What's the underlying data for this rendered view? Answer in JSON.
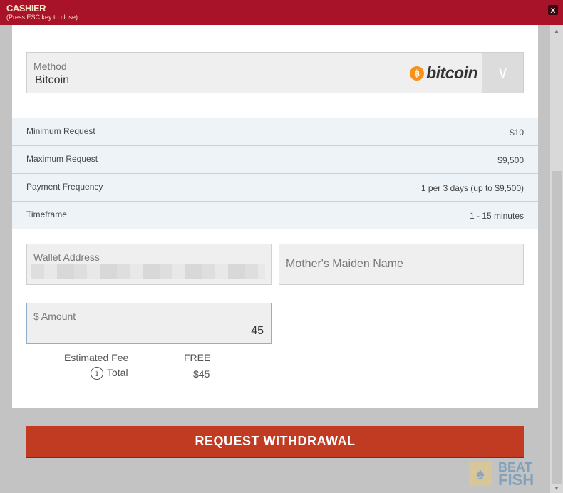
{
  "header": {
    "title": "CASHIER",
    "subtitle": "(Press ESC key to close)",
    "close": "x"
  },
  "method": {
    "label": "Method",
    "value": "Bitcoin",
    "logo_text": "bitcoin",
    "coin_symbol": "฿",
    "chevron": "∨"
  },
  "limits": [
    {
      "label": "Minimum Request",
      "value": "$10"
    },
    {
      "label": "Maximum Request",
      "value": "$9,500"
    },
    {
      "label": "Payment Frequency",
      "value": "1 per 3 days (up to $9,500)"
    },
    {
      "label": "Timeframe",
      "value": "1 - 15 minutes"
    }
  ],
  "wallet": {
    "label": "Wallet Address"
  },
  "maiden": {
    "placeholder": "Mother's Maiden Name"
  },
  "amount": {
    "label": "$ Amount",
    "value": "45"
  },
  "fee": {
    "label": "Estimated Fee",
    "value": "FREE"
  },
  "total": {
    "label": "Total",
    "value": "$45",
    "icon": "i"
  },
  "submit": "REQUEST WITHDRAWAL",
  "watermark": {
    "line1": "BEAT",
    "line2": "FISH"
  }
}
